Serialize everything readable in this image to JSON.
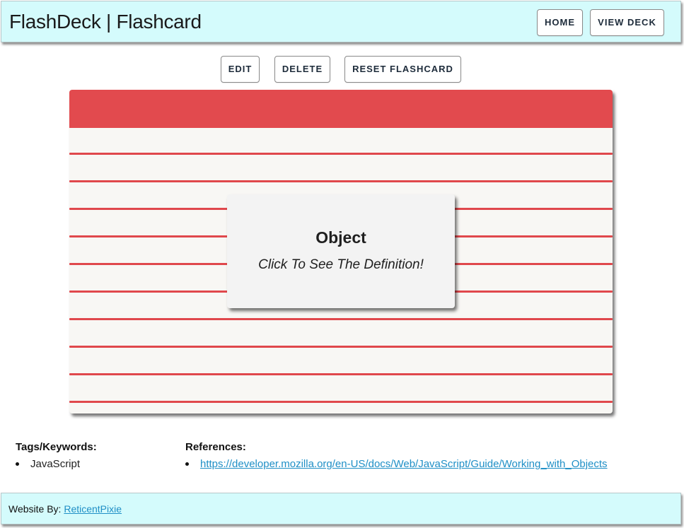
{
  "header": {
    "title": "FlashDeck | Flashcard",
    "nav": {
      "home_label": "HOME",
      "view_deck_label": "VIEW DECK"
    }
  },
  "actions": {
    "edit_label": "EDIT",
    "delete_label": "DELETE",
    "reset_label": "RESET FLASHCARD"
  },
  "card": {
    "term": "Object",
    "hint": "Click To See The Definition!",
    "band_color": "#e24a4e",
    "line_color": "#e0484c"
  },
  "tags": {
    "heading": "Tags/Keywords:",
    "items": [
      "JavaScript"
    ]
  },
  "references": {
    "heading": "References:",
    "items": [
      "https://developer.mozilla.org/en-US/docs/Web/JavaScript/Guide/Working_with_Objects"
    ]
  },
  "footer": {
    "prefix": "Website By: ",
    "author_link": "ReticentPixie"
  },
  "colors": {
    "header_bg": "#d4fbfc",
    "link": "#1f8fc6"
  }
}
